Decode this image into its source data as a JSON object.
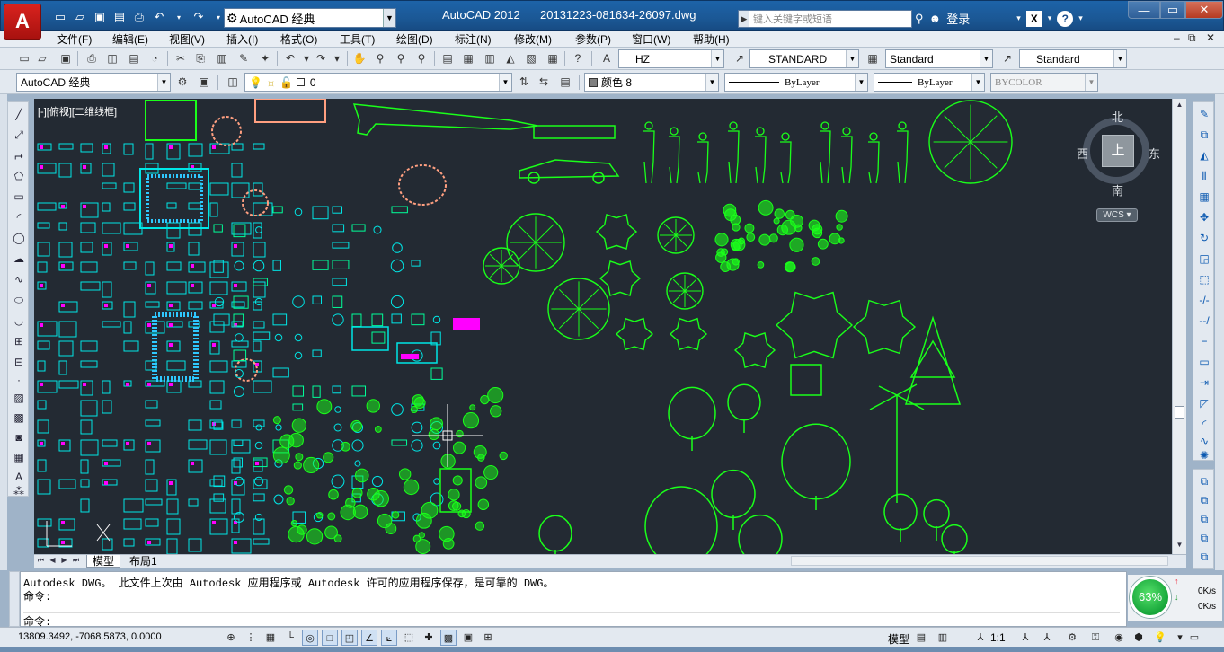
{
  "titlebar": {
    "app_title": "AutoCAD 2012",
    "file_title": "20131223-081634-26097.dwg",
    "workspace": "AutoCAD 经典",
    "search_placeholder": "键入关键字或短语",
    "login_label": "登录"
  },
  "menu": {
    "items": [
      "文件(F)",
      "编辑(E)",
      "视图(V)",
      "插入(I)",
      "格式(O)",
      "工具(T)",
      "绘图(D)",
      "标注(N)",
      "修改(M)",
      "参数(P)",
      "窗口(W)",
      "帮助(H)"
    ]
  },
  "styles_toolbar": {
    "text_style": "HZ",
    "dim_style": "STANDARD",
    "table_style": "Standard",
    "mleader_style": "Standard"
  },
  "layers_toolbar": {
    "workspace": "AutoCAD 经典",
    "layer": "0",
    "color": "颜色 8",
    "linetype": "ByLayer",
    "lineweight": "ByLayer",
    "plotstyle": "BYCOLOR"
  },
  "viewport": {
    "label": "[-][俯视][二维线框]"
  },
  "viewcube": {
    "north": "北",
    "south": "南",
    "east": "东",
    "west": "西",
    "top_face": "上",
    "wcs": "WCS"
  },
  "tabs": {
    "model": "模型",
    "layout1": "布局1"
  },
  "command": {
    "line1": "Autodesk DWG。  此文件上次由 Autodesk 应用程序或 Autodesk 许可的应用程序保存，是可靠的 DWG。",
    "line2": "命令:",
    "line3": "命令:"
  },
  "performance": {
    "percent": "63%",
    "up_rate": "0K/s",
    "down_rate": "0K/s"
  },
  "status": {
    "coords": "13809.3492, -7068.5873, 0.0000",
    "model_label": "模型",
    "scale": "1:1"
  },
  "colors": {
    "canvas_bg": "#232a33",
    "plant_green": "#1aff1a",
    "cad_cyan": "#00e6e6",
    "cad_salmon": "#ff9f80",
    "cad_magenta": "#ff00ff"
  }
}
